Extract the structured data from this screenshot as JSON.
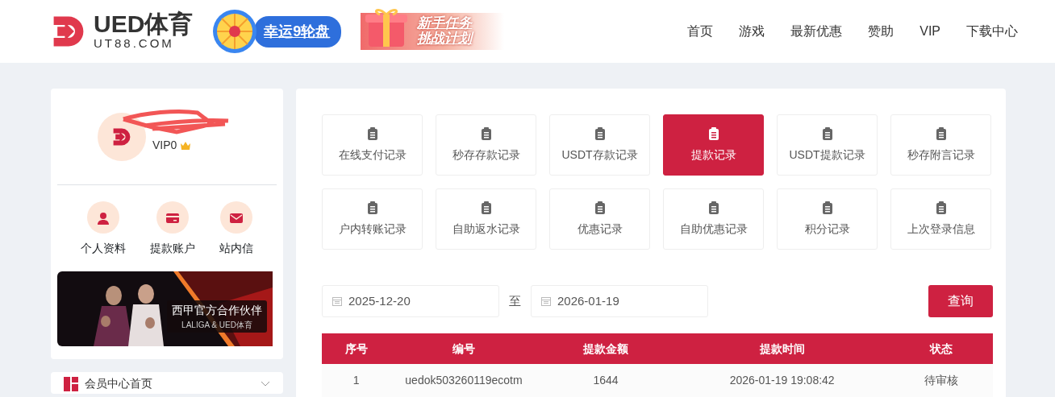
{
  "header": {
    "logo_title": "UED体育",
    "logo_subtitle": "UT88.COM",
    "promos": [
      {
        "kind": "wheel",
        "text": "幸运9轮盘"
      },
      {
        "kind": "gift",
        "lines": [
          "新手任务",
          "挑战计划"
        ]
      }
    ],
    "nav": [
      {
        "label": "首页"
      },
      {
        "label": "游戏"
      },
      {
        "label": "最新优惠"
      },
      {
        "label": "赞助"
      },
      {
        "label": "VIP"
      },
      {
        "label": "下载中心"
      }
    ]
  },
  "profile": {
    "vip": "VIP0",
    "shortcuts": [
      {
        "kind": "person",
        "label": "个人资料"
      },
      {
        "kind": "card",
        "label": "提款账户"
      },
      {
        "kind": "mail",
        "label": "站内信"
      }
    ],
    "banner": {
      "title": "西甲官方合作伙伴",
      "subtitle": "LALIGA & UED体育"
    }
  },
  "menu": [
    {
      "label": "会员中心首页"
    }
  ],
  "records": [
    {
      "label": "在线支付记录",
      "selected": false
    },
    {
      "label": "秒存存款记录",
      "selected": false
    },
    {
      "label": "USDT存款记录",
      "selected": false
    },
    {
      "label": "提款记录",
      "selected": true
    },
    {
      "label": "USDT提款记录",
      "selected": false
    },
    {
      "label": "秒存附言记录",
      "selected": false
    },
    {
      "label": "户内转账记录",
      "selected": false
    },
    {
      "label": "自助返水记录",
      "selected": false
    },
    {
      "label": "优惠记录",
      "selected": false
    },
    {
      "label": "自助优惠记录",
      "selected": false
    },
    {
      "label": "积分记录",
      "selected": false
    },
    {
      "label": "上次登录信息",
      "selected": false
    }
  ],
  "filter": {
    "start": "2025-12-20",
    "separator": "至",
    "end": "2026-01-19",
    "button": "查询"
  },
  "table": {
    "columns": [
      "序号",
      "编号",
      "提款金额",
      "提款时间",
      "状态"
    ],
    "rows": [
      [
        "1",
        "uedok503260119ecotm",
        "1644",
        "2026-01-19 19:08:42",
        "待审核"
      ]
    ]
  }
}
